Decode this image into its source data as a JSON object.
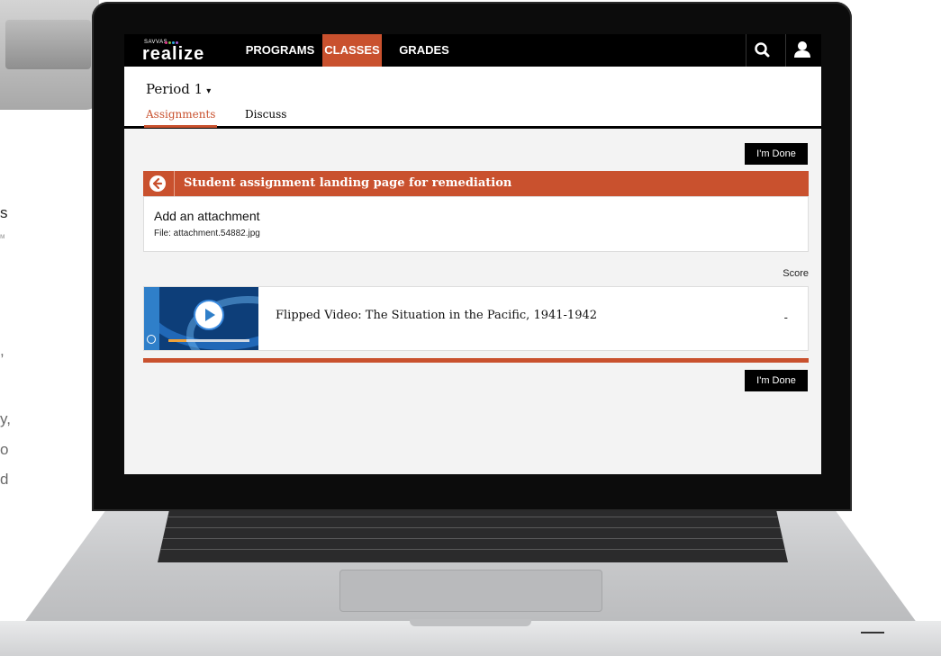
{
  "background": {
    "fragments": [
      "s",
      "ᴍ",
      ",",
      "y,",
      "o",
      "d"
    ]
  },
  "app": {
    "logo": {
      "brand": "SAVVAS",
      "name": "realize",
      "dot_colors": [
        "#e23b8c",
        "#7bc043",
        "#2aa8e0",
        "#a05ad2"
      ]
    },
    "nav": {
      "items": [
        {
          "label": "PROGRAMS",
          "active": false
        },
        {
          "label": "CLASSES",
          "active": true
        },
        {
          "label": "GRADES",
          "active": false
        }
      ],
      "icons": [
        "search-icon",
        "user-icon"
      ]
    },
    "class_selector": {
      "label": "Period 1",
      "caret": "▾"
    },
    "tabs": [
      {
        "label": "Assignments",
        "active": true
      },
      {
        "label": "Discuss",
        "active": false
      }
    ],
    "done_label": "I'm Done",
    "banner": {
      "icon": "back-arrow-icon",
      "title": "Student assignment landing page for remediation"
    },
    "attachment": {
      "title": "Add an attachment",
      "file": "File: attachment.54882.jpg"
    },
    "score_label": "Score",
    "video": {
      "title": "Flipped Video: The Situation in the Pacific, 1941-1942",
      "score": "-",
      "progress": 0.22
    },
    "colors": {
      "accent": "#c9512e",
      "nav": "#000000",
      "video_strip": "#2f7fc9"
    }
  }
}
